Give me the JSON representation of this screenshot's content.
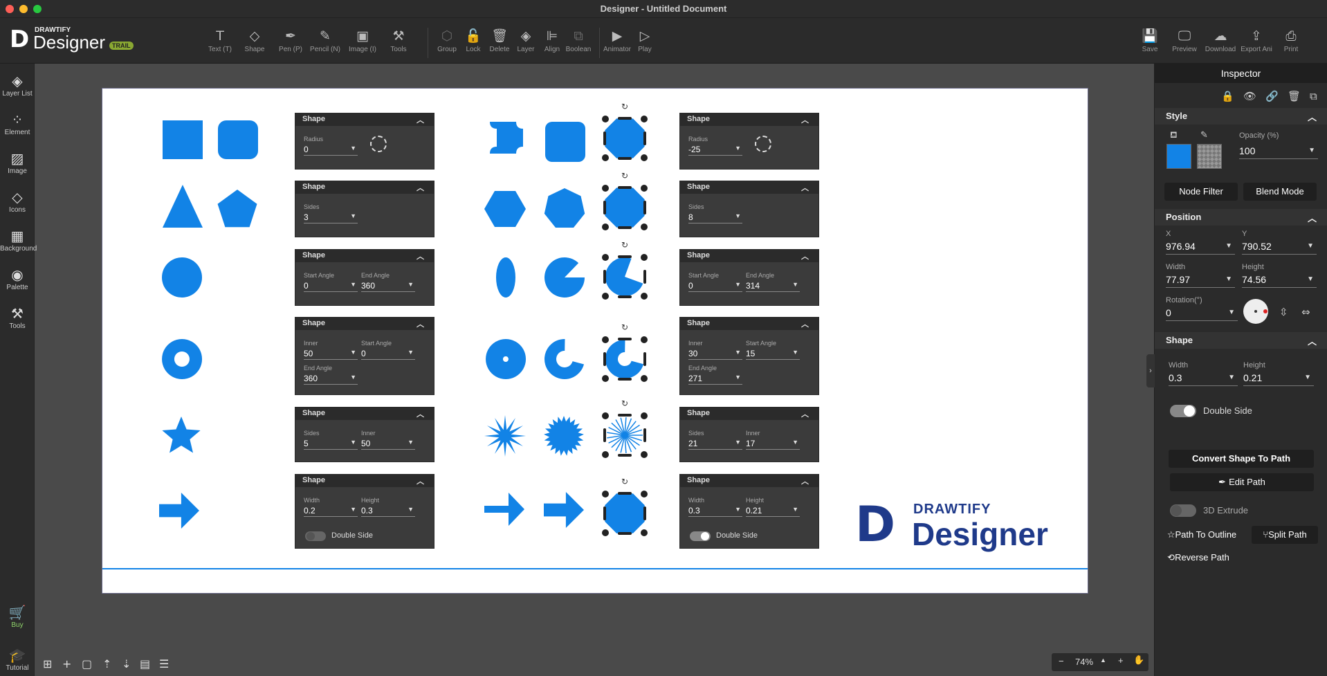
{
  "window": {
    "title": "Designer - Untitled Document"
  },
  "brand": {
    "line1": "DRAWTIFY",
    "line2": "Designer",
    "badge": "TRAIL"
  },
  "toolbar": {
    "tools": [
      {
        "label": "Text (T)",
        "glyph": "T"
      },
      {
        "label": "Shape",
        "glyph": "◇"
      },
      {
        "label": "Pen (P)",
        "glyph": "✒"
      },
      {
        "label": "Pencil (N)",
        "glyph": "✎"
      },
      {
        "label": "Image (I)",
        "glyph": "▣"
      },
      {
        "label": "Tools",
        "glyph": "⚒"
      },
      {
        "label": "Group",
        "glyph": "⬡"
      },
      {
        "label": "Lock",
        "glyph": "🔓"
      },
      {
        "label": "Delete",
        "glyph": "🗑"
      },
      {
        "label": "Layer",
        "glyph": "◈"
      },
      {
        "label": "Align",
        "glyph": "⊫"
      },
      {
        "label": "Boolean",
        "glyph": "⧉"
      },
      {
        "label": "Animator",
        "glyph": "▶"
      },
      {
        "label": "Play",
        "glyph": "▷"
      }
    ],
    "right": [
      {
        "label": "Save",
        "glyph": "💾"
      },
      {
        "label": "Preview",
        "glyph": "🖵"
      },
      {
        "label": "Download",
        "glyph": "☁"
      },
      {
        "label": "Export Ani",
        "glyph": "⇪"
      },
      {
        "label": "Print",
        "glyph": "⎙"
      }
    ]
  },
  "sidebar": {
    "items": [
      {
        "label": "Layer List",
        "glyph": "◈"
      },
      {
        "label": "Element",
        "glyph": "⁘"
      },
      {
        "label": "Image",
        "glyph": "▨"
      },
      {
        "label": "Icons",
        "glyph": "◇"
      },
      {
        "label": "Background",
        "glyph": "▦"
      },
      {
        "label": "Palette",
        "glyph": "◉"
      },
      {
        "label": "Tools",
        "glyph": "⚒"
      }
    ],
    "buy": {
      "label": "Buy",
      "glyph": "🛒"
    },
    "tutorial": {
      "label": "Tutorial",
      "glyph": "🎓"
    }
  },
  "canvas": {
    "panel_title": "Shape",
    "left_panels": [
      {
        "fields": [
          {
            "label": "Radius",
            "value": "0"
          }
        ]
      },
      {
        "fields": [
          {
            "label": "Sides",
            "value": "3"
          }
        ]
      },
      {
        "fields": [
          {
            "label": "Start Angle",
            "value": "0"
          },
          {
            "label": "End Angle",
            "value": "360"
          }
        ]
      },
      {
        "fields": [
          {
            "label": "Inner",
            "value": "50"
          },
          {
            "label": "Start Angle",
            "value": "0"
          },
          {
            "label": "End Angle",
            "value": "360"
          }
        ]
      },
      {
        "fields": [
          {
            "label": "Sides",
            "value": "5"
          },
          {
            "label": "Inner",
            "value": "50"
          }
        ]
      },
      {
        "fields": [
          {
            "label": "Width",
            "value": "0.2"
          },
          {
            "label": "Height",
            "value": "0.3"
          }
        ],
        "toggle": "Double Side"
      }
    ],
    "right_panels": [
      {
        "fields": [
          {
            "label": "Radius",
            "value": "-25"
          }
        ]
      },
      {
        "fields": [
          {
            "label": "Sides",
            "value": "8"
          }
        ]
      },
      {
        "fields": [
          {
            "label": "Start Angle",
            "value": "0"
          },
          {
            "label": "End Angle",
            "value": "314"
          }
        ]
      },
      {
        "fields": [
          {
            "label": "Inner",
            "value": "30"
          },
          {
            "label": "Start Angle",
            "value": "15"
          },
          {
            "label": "End Angle",
            "value": "271"
          }
        ]
      },
      {
        "fields": [
          {
            "label": "Sides",
            "value": "21"
          },
          {
            "label": "Inner",
            "value": "17"
          }
        ]
      },
      {
        "fields": [
          {
            "label": "Width",
            "value": "0.3"
          },
          {
            "label": "Height",
            "value": "0.21"
          }
        ],
        "toggle": "Double Side"
      }
    ],
    "logo": {
      "line1": "DRAWTIFY",
      "line2": "Designer"
    },
    "shape_color": "#1283e6"
  },
  "inspector": {
    "title": "Inspector",
    "style": {
      "title": "Style",
      "opacity_label": "Opacity (%)",
      "opacity": "100",
      "node_filter": "Node Filter",
      "blend_mode": "Blend Mode",
      "fill_color": "#1283e6"
    },
    "position": {
      "title": "Position",
      "x_label": "X",
      "x": "976.94",
      "y_label": "Y",
      "y": "790.52",
      "w_label": "Width",
      "w": "77.97",
      "h_label": "Height",
      "h": "74.56",
      "rot_label": "Rotation(°)",
      "rot": "0"
    },
    "shape": {
      "title": "Shape",
      "w_label": "Width",
      "w": "0.3",
      "h_label": "Height",
      "h": "0.21",
      "double_side": "Double Side",
      "convert": "Convert Shape To Path",
      "edit_path": "Edit Path",
      "extrude": "3D Extrude",
      "outline": "Path To Outline",
      "split": "Split Path",
      "reverse": "Reverse Path"
    }
  },
  "zoom": {
    "value": "74%"
  }
}
